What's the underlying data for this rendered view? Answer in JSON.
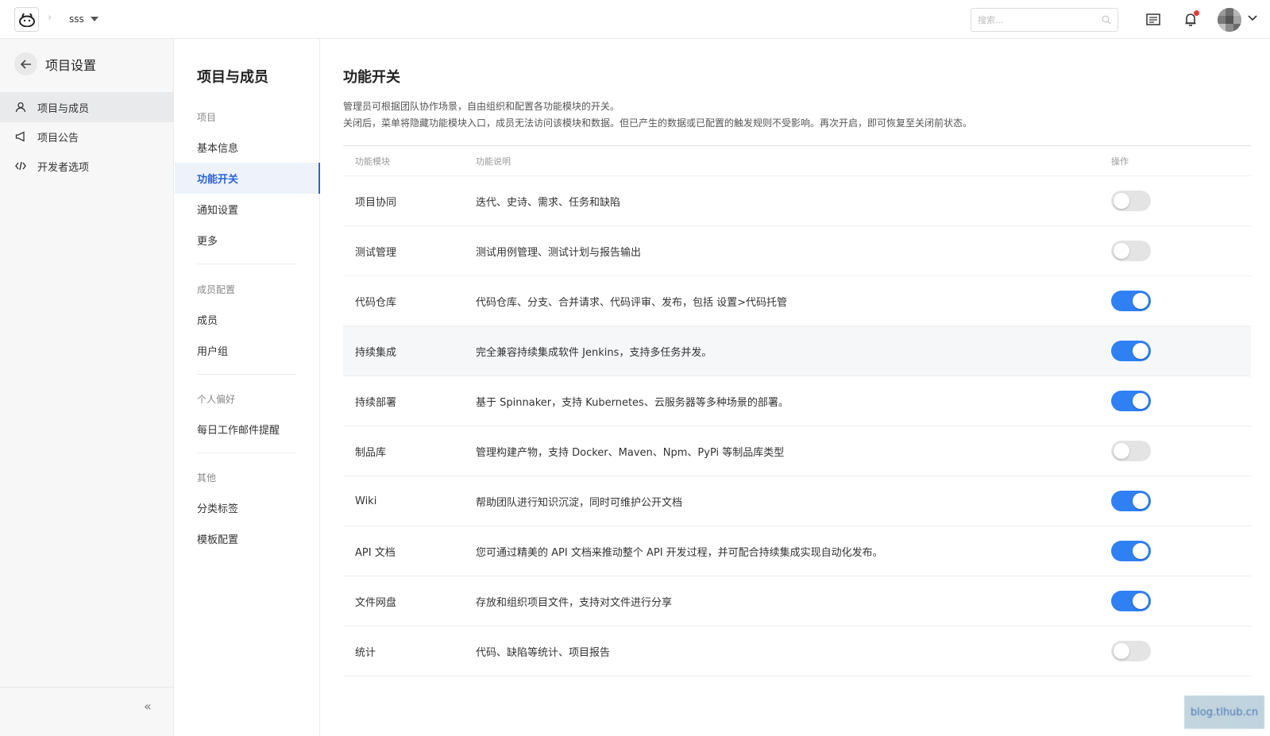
{
  "topbar": {
    "project_name": "sss",
    "search_placeholder": "搜索..."
  },
  "sidebar": {
    "title": "项目设置",
    "items": [
      {
        "label": "项目与成员",
        "icon": "user-icon",
        "active": true
      },
      {
        "label": "项目公告",
        "icon": "megaphone-icon",
        "active": false
      },
      {
        "label": "开发者选项",
        "icon": "code-icon",
        "active": false
      }
    ],
    "collapse_label": "«"
  },
  "nav2": {
    "title": "项目与成员",
    "groups": [
      {
        "label": "项目",
        "items": [
          "基本信息",
          "功能开关",
          "通知设置",
          "更多"
        ]
      },
      {
        "label": "成员配置",
        "items": [
          "成员",
          "用户组"
        ]
      },
      {
        "label": "个人偏好",
        "items": [
          "每日工作邮件提醒"
        ]
      },
      {
        "label": "其他",
        "items": [
          "分类标签",
          "模板配置"
        ]
      }
    ],
    "active_item": "功能开关"
  },
  "main": {
    "title": "功能开关",
    "desc_line1": "管理员可根据团队协作场景，自由组织和配置各功能模块的开关。",
    "desc_line2": "关闭后，菜单将隐藏功能模块入口，成员无法访问该模块和数据。但已产生的数据或已配置的触发规则不受影响。再次开启，即可恢复至关闭前状态。",
    "columns": [
      "功能模块",
      "功能说明",
      "操作"
    ],
    "rows": [
      {
        "name": "项目协同",
        "desc": "迭代、史诗、需求、任务和缺陷",
        "enabled": false
      },
      {
        "name": "测试管理",
        "desc": "测试用例管理、测试计划与报告输出",
        "enabled": false
      },
      {
        "name": "代码仓库",
        "desc": "代码仓库、分支、合并请求、代码评审、发布，包括 设置>代码托管",
        "enabled": true
      },
      {
        "name": "持续集成",
        "desc": "完全兼容持续集成软件 Jenkins，支持多任务并发。",
        "enabled": true
      },
      {
        "name": "持续部署",
        "desc": "基于 Spinnaker，支持 Kubernetes、云服务器等多种场景的部署。",
        "enabled": true
      },
      {
        "name": "制品库",
        "desc": "管理构建产物，支持 Docker、Maven、Npm、PyPi 等制品库类型",
        "enabled": false
      },
      {
        "name": "Wiki",
        "desc": "帮助团队进行知识沉淀，同时可维护公开文档",
        "enabled": true
      },
      {
        "name": "API 文档",
        "desc": "您可通过精美的 API 文档来推动整个 API 开发过程，并可配合持续集成实现自动化发布。",
        "enabled": true
      },
      {
        "name": "文件网盘",
        "desc": "存放和组织项目文件，支持对文件进行分享",
        "enabled": true
      },
      {
        "name": "统计",
        "desc": "代码、缺陷等统计、项目报告",
        "enabled": false
      }
    ]
  },
  "watermark": "blog.tlhub.cn",
  "colors": {
    "accent": "#2f80f2",
    "toggle_off": "#e4e4e4",
    "active_nav": "#2b63d9"
  }
}
